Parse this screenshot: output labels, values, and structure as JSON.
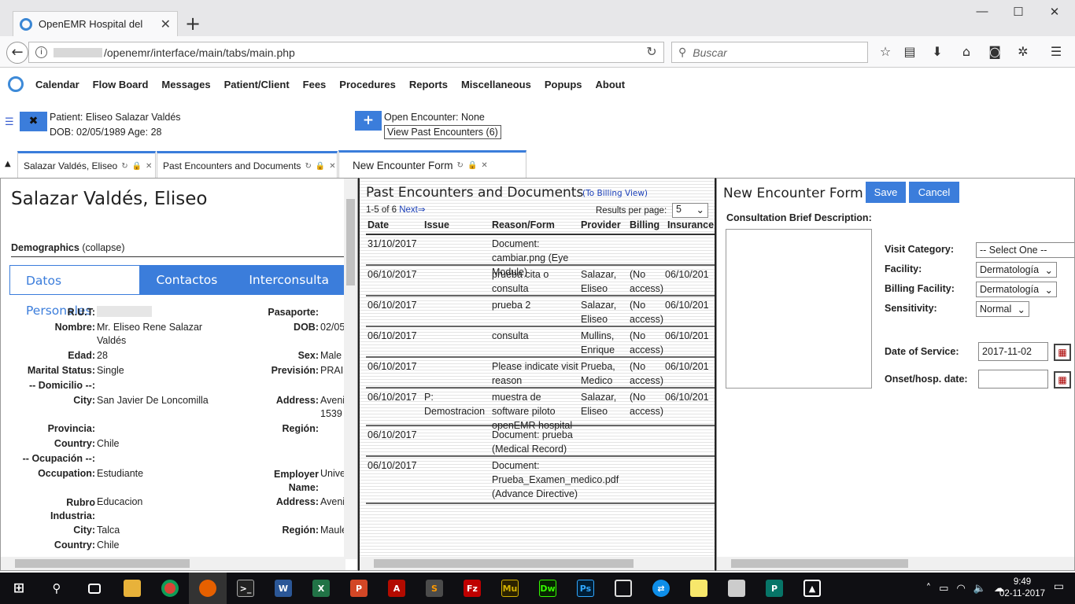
{
  "browser": {
    "tab_title": "OpenEMR Hospital del ",
    "url": "/openemr/interface/main/tabs/main.php",
    "search_placeholder": "Buscar",
    "tab_close": "✕",
    "new_tab": "+"
  },
  "menu": [
    "Calendar",
    "Flow Board",
    "Messages",
    "Patient/Client",
    "Fees",
    "Procedures",
    "Reports",
    "Miscellaneous",
    "Popups",
    "About"
  ],
  "patient_bar": {
    "patient": "Patient: Eliseo Salazar Valdés",
    "dob": "DOB: 02/05/1989 Age: 28",
    "open_encounter": "Open Encounter: None",
    "view_past": "View Past Encounters (6)",
    "close_x": "✖",
    "plus": "+"
  },
  "app_tabs": [
    {
      "label": "Salazar Valdés, Eliseo"
    },
    {
      "label": "Past Encounters and Documents"
    },
    {
      "label": "New Encounter Form"
    }
  ],
  "demographics": {
    "name": "Salazar Valdés, Eliseo",
    "section": "Demographics",
    "collapse": " (collapse)",
    "tabs": [
      "Datos Personales",
      "Contactos",
      "Interconsulta"
    ],
    "left": [
      {
        "label": "R.U.T:",
        "value": ""
      },
      {
        "label": "Nombre:",
        "value": "Mr. Eliseo Rene Salazar Valdés"
      },
      {
        "label": "Edad:",
        "value": "28"
      },
      {
        "label": "Marital Status:",
        "value": "Single"
      },
      {
        "label": "-- Domicilio --:",
        "value": ""
      },
      {
        "label": "City:",
        "value": "San Javier De Loncomilla"
      },
      {
        "label": "Provincia:",
        "value": ""
      },
      {
        "label": "Country:",
        "value": "Chile"
      },
      {
        "label": "-- Ocupación --:",
        "value": ""
      },
      {
        "label": "Occupation:",
        "value": "Estudiante"
      },
      {
        "label": "Rubro Industria:",
        "value": "Educacion"
      },
      {
        "label": "City:",
        "value": "Talca"
      },
      {
        "label": "Country:",
        "value": "Chile"
      }
    ],
    "right": [
      {
        "label": "Pasaporte:",
        "value": ""
      },
      {
        "label": "DOB:",
        "value": "02/05"
      },
      {
        "label": "Sex:",
        "value": "Male"
      },
      {
        "label": "Previsión:",
        "value": "PRAIS"
      },
      {
        "label": "Address:",
        "value": "Aveni 1539"
      },
      {
        "label": "Región:",
        "value": ""
      },
      {
        "label": "Employer Name:",
        "value": "Unive"
      },
      {
        "label": "Address:",
        "value": "Aveni"
      },
      {
        "label": "Región:",
        "value": "Maule"
      }
    ]
  },
  "encounters": {
    "title": "Past Encounters and Documents",
    "billing_view": "(To Billing View)",
    "count": "1-5 of 6",
    "next": "Next⇒",
    "results_per_page": "Results per page:",
    "per_page_value": "5",
    "headers": [
      "Date",
      "Issue",
      "Reason/Form",
      "Provider",
      "Billing",
      "Insurance"
    ],
    "rows": [
      {
        "date": "31/10/2017",
        "issue": "",
        "reason": "Document: cambiar.png (Eye Module)",
        "provider": "",
        "billing": "",
        "insurance": ""
      },
      {
        "date": "06/10/2017",
        "issue": "",
        "reason": "prueba cita o consulta",
        "provider": "Salazar, Eliseo",
        "billing": "(No access)",
        "insurance": "06/10/201"
      },
      {
        "date": "06/10/2017",
        "issue": "",
        "reason": "prueba 2",
        "provider": "Salazar, Eliseo",
        "billing": "(No access)",
        "insurance": "06/10/201"
      },
      {
        "date": "06/10/2017",
        "issue": "",
        "reason": "consulta",
        "provider": "Mullins, Enrique",
        "billing": "(No access)",
        "insurance": "06/10/201"
      },
      {
        "date": "06/10/2017",
        "issue": "",
        "reason": "Please indicate visit reason",
        "provider": "Prueba, Medico",
        "billing": "(No access)",
        "insurance": "06/10/201"
      },
      {
        "date": "06/10/2017",
        "issue": "P: Demostracion",
        "reason": "muestra de software piloto openEMR hospital",
        "provider": "Salazar, Eliseo",
        "billing": "(No access)",
        "insurance": "06/10/201"
      },
      {
        "date": "06/10/2017",
        "issue": "",
        "reason": "Document: prueba (Medical Record)",
        "provider": "",
        "billing": "",
        "insurance": ""
      },
      {
        "date": "06/10/2017",
        "issue": "",
        "reason": "Document: Prueba_Examen_medico.pdf (Advance Directive)",
        "provider": "",
        "billing": "",
        "insurance": ""
      }
    ]
  },
  "new_encounter": {
    "title": "New Encounter Form",
    "save": "Save",
    "cancel": "Cancel",
    "brief_label": "Consultation Brief Description:",
    "visit_category_label": "Visit Category:",
    "visit_category_value": "-- Select One --",
    "facility_label": "Facility:",
    "facility_value": "Dermatología",
    "billing_facility_label": "Billing Facility:",
    "billing_facility_value": "Dermatología",
    "sensitivity_label": "Sensitivity:",
    "sensitivity_value": "Normal",
    "dos_label": "Date of Service:",
    "dos_value": "2017-11-02",
    "onset_label": "Onset/hosp. date:",
    "onset_value": ""
  },
  "taskbar": {
    "time": "9:49",
    "date": "02-11-2017"
  }
}
